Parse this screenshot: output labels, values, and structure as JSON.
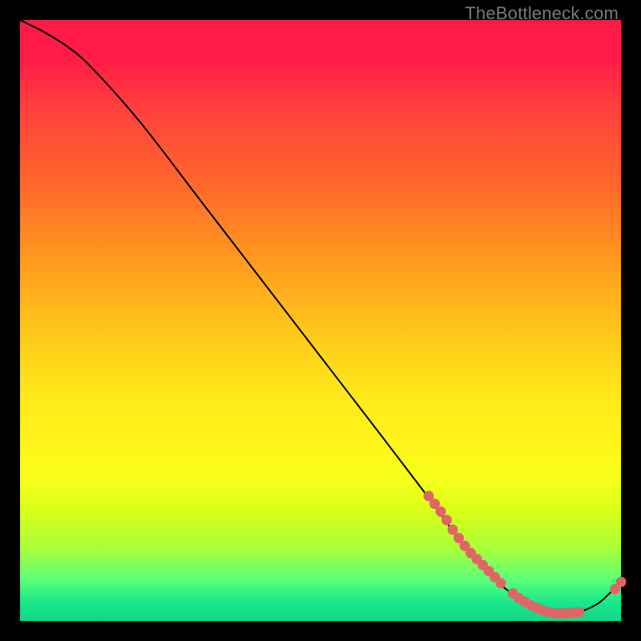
{
  "watermark": "TheBottleneck.com",
  "chart_data": {
    "type": "line",
    "title": "",
    "xlabel": "",
    "ylabel": "",
    "xlim": [
      0,
      100
    ],
    "ylim": [
      0,
      100
    ],
    "series": [
      {
        "name": "curve",
        "x": [
          0,
          4,
          8,
          12,
          20,
          30,
          40,
          50,
          60,
          68,
          72,
          76,
          80,
          84,
          87,
          90,
          93,
          96,
          98,
          100
        ],
        "y": [
          100,
          98,
          95.5,
          92,
          83,
          70,
          57,
          44,
          31,
          20.5,
          15,
          10,
          6,
          3.2,
          1.8,
          1.3,
          1.5,
          2.8,
          4.5,
          6.5
        ]
      }
    ],
    "markers": [
      {
        "x": 68.0,
        "y": 20.8
      },
      {
        "x": 69.0,
        "y": 19.5
      },
      {
        "x": 70.0,
        "y": 18.2
      },
      {
        "x": 71.0,
        "y": 16.8
      },
      {
        "x": 72.0,
        "y": 15.2
      },
      {
        "x": 73.0,
        "y": 13.8
      },
      {
        "x": 74.0,
        "y": 12.5
      },
      {
        "x": 75.0,
        "y": 11.3
      },
      {
        "x": 76.0,
        "y": 10.3
      },
      {
        "x": 77.0,
        "y": 9.3
      },
      {
        "x": 78.0,
        "y": 8.3
      },
      {
        "x": 79.0,
        "y": 7.3
      },
      {
        "x": 80.0,
        "y": 6.3
      },
      {
        "x": 82.0,
        "y": 4.6
      },
      {
        "x": 83.0,
        "y": 3.8
      },
      {
        "x": 84.0,
        "y": 3.2
      },
      {
        "x": 85.0,
        "y": 2.6
      },
      {
        "x": 86.0,
        "y": 2.2
      },
      {
        "x": 87.0,
        "y": 1.8
      },
      {
        "x": 88.0,
        "y": 1.5
      },
      {
        "x": 89.0,
        "y": 1.3
      },
      {
        "x": 90.0,
        "y": 1.3
      },
      {
        "x": 91.0,
        "y": 1.3
      },
      {
        "x": 92.0,
        "y": 1.4
      },
      {
        "x": 93.0,
        "y": 1.5
      },
      {
        "x": 99.0,
        "y": 5.3
      },
      {
        "x": 100.0,
        "y": 6.5
      }
    ],
    "marker_color": "#e06666",
    "line_color": "#000000"
  }
}
